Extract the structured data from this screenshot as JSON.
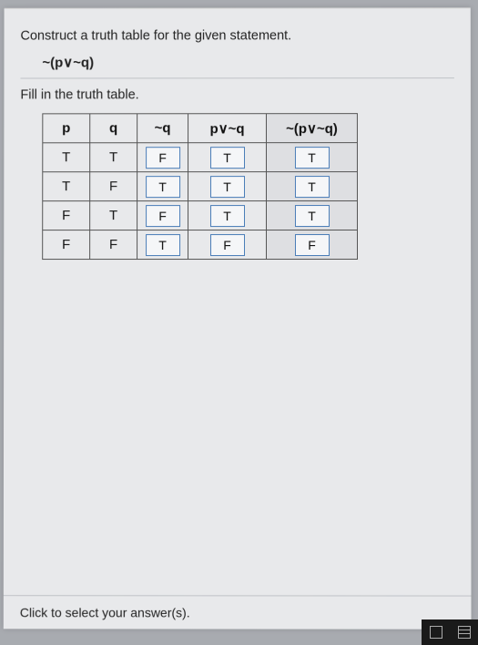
{
  "instruction": "Construct a truth table for the given statement.",
  "statement": "~(p∨~q)",
  "fill_line": "Fill in the truth table.",
  "table": {
    "headers": [
      "p",
      "q",
      "~q",
      "p∨~q",
      "~(p∨~q)"
    ],
    "rows": [
      {
        "p": "T",
        "q": "T",
        "nq": "F",
        "pvnq": "T",
        "final": "T"
      },
      {
        "p": "T",
        "q": "F",
        "nq": "T",
        "pvnq": "T",
        "final": "T"
      },
      {
        "p": "F",
        "q": "T",
        "nq": "F",
        "pvnq": "T",
        "final": "T"
      },
      {
        "p": "F",
        "q": "F",
        "nq": "T",
        "pvnq": "F",
        "final": "F"
      }
    ]
  },
  "footer_hint": "Click to select your answer(s)."
}
